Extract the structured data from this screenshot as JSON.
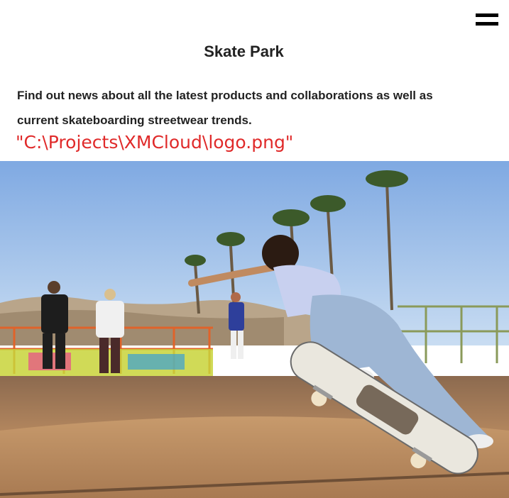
{
  "header": {
    "menu_icon": "hamburger-menu-icon"
  },
  "page": {
    "title": "Skate Park",
    "intro_line1": "Find out news about all the latest products and collaborations as well as",
    "intro_line2": "current skateboarding streetwear trends.",
    "logo_path": "\"C:\\Projects\\XMCloud\\logo.png\""
  },
  "colors": {
    "text": "#222222",
    "logo_path_text": "#e02a2a",
    "sky": "#8fb6e6",
    "ramp": "#a77a55"
  }
}
